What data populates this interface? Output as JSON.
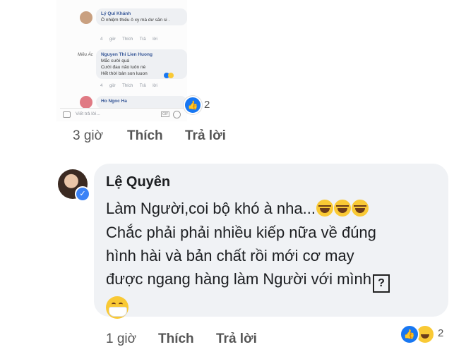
{
  "mini": {
    "comments": [
      {
        "name": "Lý Quí Khánh",
        "text": "Ô nhiệm thiếu ô xy mà dư săn si .",
        "time": "4 giờ",
        "like": "Thích",
        "reply": "Trả lời",
        "avatar_color": "#c9a080"
      },
      {
        "name": "Nguyen Thi Lien Huong",
        "text1": "Mắc cười quá",
        "text2": "Cười đau não luôn nè",
        "text3": "Hết thời bán son luuon",
        "time": "4 giờ",
        "like": "Thích",
        "reply": "Trả lời",
        "avatar_label": "Miêu Ác"
      },
      {
        "name": "Ho Ngoc Ha",
        "avatar_color": "#e07a84"
      }
    ],
    "input_placeholder": "Viết trả lời...",
    "gif": "GIF"
  },
  "upper": {
    "time": "3 giờ",
    "like": "Thích",
    "reply": "Trả lời",
    "reaction_count": "2"
  },
  "comment": {
    "author": "Lệ Quyên",
    "line1": "Làm Người,coi bộ khó à nha...",
    "line2": "Chắc phải phải nhiều kiếp nữa về đúng",
    "line3": "hình hài và bản chất rồi mới cơ may",
    "line4": "được ngang hàng làm Người với mình",
    "qmark": "?",
    "time": "1 giờ",
    "like": "Thích",
    "reply": "Trả lời",
    "reaction_count": "2"
  },
  "colors": {
    "link": "#385898",
    "bubble": "#f0f2f5",
    "like_blue": "#1877f2",
    "emoji_yellow": "#f9c935"
  }
}
